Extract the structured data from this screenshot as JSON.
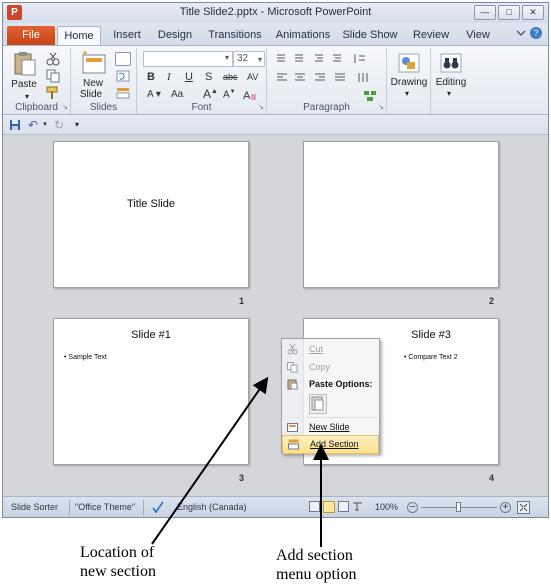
{
  "window": {
    "title": "Title Slide2.pptx - Microsoft PowerPoint",
    "app_icon": "P"
  },
  "ribbon_tabs": [
    "File",
    "Home",
    "Insert",
    "Design",
    "Transitions",
    "Animations",
    "Slide Show",
    "Review",
    "View"
  ],
  "ribbon": {
    "clipboard": {
      "paste": "Paste",
      "label": "Clipboard"
    },
    "slides": {
      "new_slide_line1": "New",
      "new_slide_line2": "Slide",
      "label": "Slides"
    },
    "font": {
      "size": "32",
      "bold": "B",
      "italic": "I",
      "underline": "U",
      "strike": "S",
      "abc": "abc",
      "av": "AV",
      "aa": "Aa",
      "label": "Font"
    },
    "paragraph": {
      "label": "Paragraph"
    },
    "drawing": {
      "label": "Drawing"
    },
    "editing": {
      "label": "Editing"
    }
  },
  "slides": [
    {
      "number": "1",
      "title": "Title Slide"
    },
    {
      "number": "2",
      "title": ""
    },
    {
      "number": "3",
      "title": "Slide #1",
      "bullet": "Sample Text"
    },
    {
      "number": "4",
      "title": "Slide #3",
      "bullet": "Compare Text 2"
    }
  ],
  "context_menu": {
    "cut": "Cut",
    "copy": "Copy",
    "paste_options": "Paste Options:",
    "new_slide": "New Slide",
    "add_section": "Add Section"
  },
  "status_bar": {
    "view": "Slide Sorter",
    "theme": "\"Office Theme\"",
    "language": "English (Canada)",
    "zoom": "100%"
  },
  "annotations": {
    "left_line1": "Location of",
    "left_line2": "new section",
    "right_line1": "Add section",
    "right_line2": "menu option"
  },
  "colors": {
    "file_tab": "#d0501f",
    "menu_highlight": "#fbe08c",
    "sorter_bg": "#d4d6da"
  }
}
